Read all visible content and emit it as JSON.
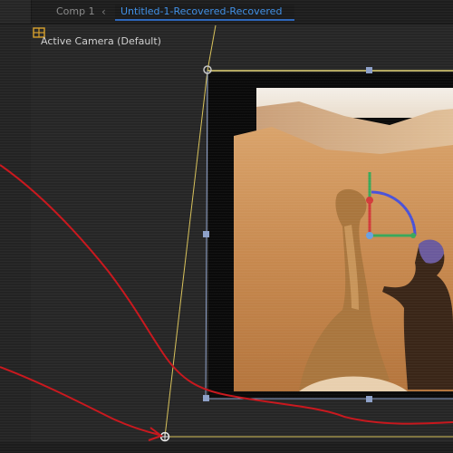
{
  "tabs": {
    "comp_label": "Comp 1",
    "chevron": "‹",
    "active_label": "Untitled-1-Recovered-Recovered"
  },
  "viewer": {
    "camera_label": "Active Camera (Default)"
  },
  "icons": {
    "camera_grid": "grid-icon",
    "gizmo": "rotation-gizmo-icon"
  },
  "colors": {
    "accent": "#3f8fe6",
    "layer_outline": "#e0d070",
    "handle": "#8da0c8",
    "annotation": "#d11f1f"
  }
}
